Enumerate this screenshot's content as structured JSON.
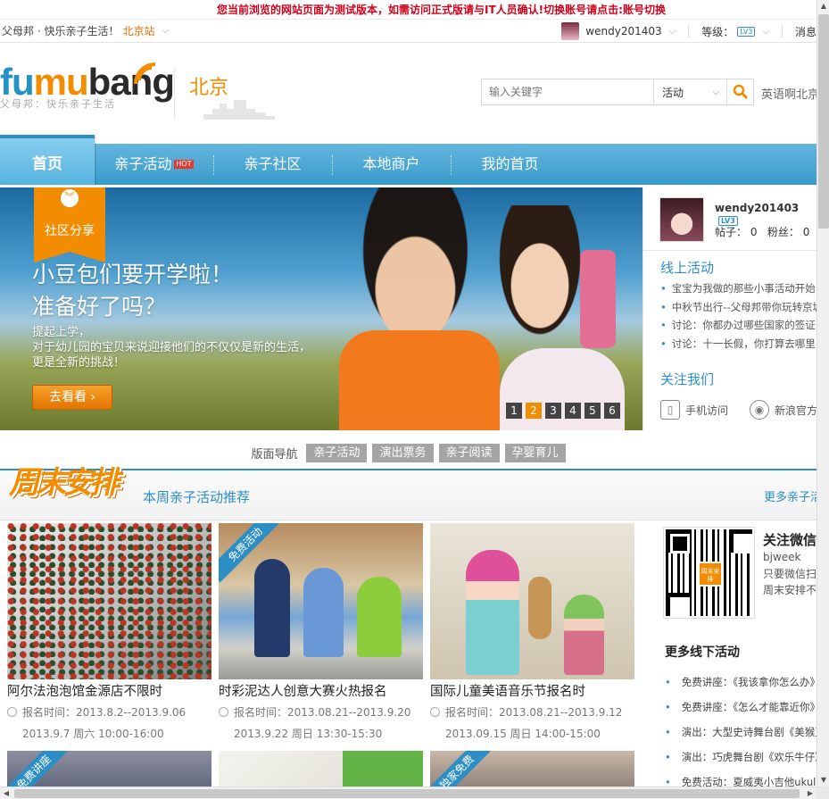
{
  "notice": "您当前浏览的网站页面为测试版本，如需访问正式版请与IT人员确认!切换账号请点击:账号切换",
  "topbar": {
    "site": "父母邦 · 快乐亲子生活！",
    "city": "北京站",
    "username": "wendy201403",
    "level_label": "等级：",
    "level_badge": "LV3",
    "messages": "消息"
  },
  "header": {
    "logo_f": "f",
    "logo_u": "u",
    "logo_m": "m",
    "logo_u2": "u",
    "logo_bang": "bang",
    "tagline": "父母邦：快乐亲子生活",
    "city": "北京",
    "search_placeholder": "输入关键字",
    "search_type": "活动",
    "hot_search": "英语啊北京"
  },
  "nav": {
    "home": "首页",
    "items": [
      {
        "label": "亲子活动",
        "hot": "HOT"
      },
      {
        "label": "亲子社区"
      },
      {
        "label": "本地商户"
      },
      {
        "label": "我的首页"
      }
    ]
  },
  "banner": {
    "ribbon": "社区分享",
    "title1": "小豆包们要开学啦！",
    "title2": "准备好了吗？",
    "sub1": "提起上学，",
    "sub2": "对于幼儿园的宝贝来说迎接他们的不仅仅是新的生活，",
    "sub3": "更是全新的挑战！",
    "button": "去看看 ›",
    "pages": [
      "1",
      "2",
      "3",
      "4",
      "5",
      "6"
    ],
    "current_page": "2"
  },
  "side": {
    "username": "wendy201403",
    "badge": "LV3",
    "posts": "帖子：  0",
    "fans": "粉丝：  0",
    "online_title": "线上活动",
    "online_items": [
      "宝宝为我做的那些小事活动开始",
      "中秋节出行--父母邦带你玩转京城",
      "讨论：你都办过哪些国家的签证",
      "讨论：十一长假，你打算去哪里"
    ],
    "follow_title": "关注我们",
    "mobile": "手机访问",
    "weibo": "新浪官方微博"
  },
  "section_nav": {
    "label": "版面导航",
    "tags": [
      "亲子活动",
      "演出票务",
      "亲子阅读",
      "孕婴育儿"
    ]
  },
  "weekend": {
    "logo": "周末安排",
    "title": "本周亲子活动推荐",
    "more": "更多亲子活动"
  },
  "cards": [
    {
      "title": "阿尔法泡泡馆金源店不限时",
      "reg": "报名时间：2013.8.2--2013.9.06",
      "date": "2013.9.7",
      "week": "周六",
      "time": "10:00-16:00",
      "badge": ""
    },
    {
      "title": "时彩泥达人创意大赛火热报名",
      "reg": "报名时间：2013.08.21--2013.9.20",
      "date": "2013.9.22",
      "week": "周日",
      "time": "13:30-15:30",
      "badge": "免费活动"
    },
    {
      "title": "国际儿童美语音乐节报名时",
      "reg": "报名时间：2013.08.21--2013.9.12",
      "date": "2013.09.15",
      "week": "周日",
      "time": "14:00-15:00",
      "badge": ""
    }
  ],
  "row2_badges": [
    "免费讲座",
    "",
    "独家免费"
  ],
  "wechat": {
    "title": "关注微信",
    "id": "bjweek",
    "desc1": "只要微信扫描",
    "desc2": "周末安排不用愁",
    "qr_label": "周末安排"
  },
  "more_offline": {
    "title": "更多线下活动",
    "items": [
      "免费讲座：《我该拿你怎么办》",
      "免费讲座：《怎么才能靠近你》",
      "演出：大型史诗舞台剧《美猴王》",
      "演出：巧虎舞台剧《欢乐牛仔》",
      "免费活动：夏威夷小吉他ukulele"
    ]
  }
}
